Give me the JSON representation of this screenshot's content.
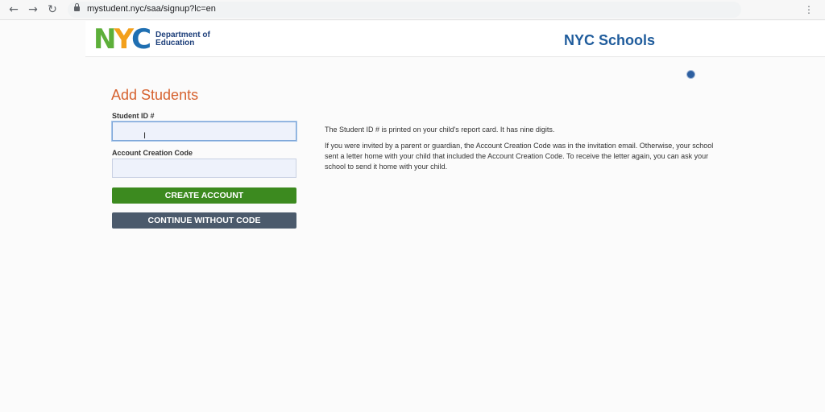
{
  "browser": {
    "url": "mystudent.nyc/saa/signup?lc=en",
    "back_icon": "arrow-left-icon",
    "forward_icon": "arrow-right-icon",
    "reload_icon": "reload-icon"
  },
  "header": {
    "logo_text": "NYC",
    "department_text": "Department of Education",
    "site_title": "NYC Schools"
  },
  "form": {
    "title": "Add Students",
    "student_id_label": "Student ID #",
    "student_id_value": "",
    "account_code_label": "Account Creation Code",
    "account_code_value": "",
    "create_button": "CREATE ACCOUNT",
    "continue_button": "CONTINUE WITHOUT CODE"
  },
  "info": {
    "paragraph1": "The Student ID # is printed on your child's report card. It has nine digits.",
    "paragraph2": "If you were invited by a parent or guardian, the Account Creation Code was in the invitation email. Otherwise, your school sent a letter home with your child that included the Account Creation Code. To receive the letter again, you can ask your school to send it home with your child."
  },
  "colors": {
    "heading": "#d6622f",
    "primary_button": "#3c8a1f",
    "secondary_button": "#4b5a6c",
    "site_title": "#1f5c9c"
  }
}
